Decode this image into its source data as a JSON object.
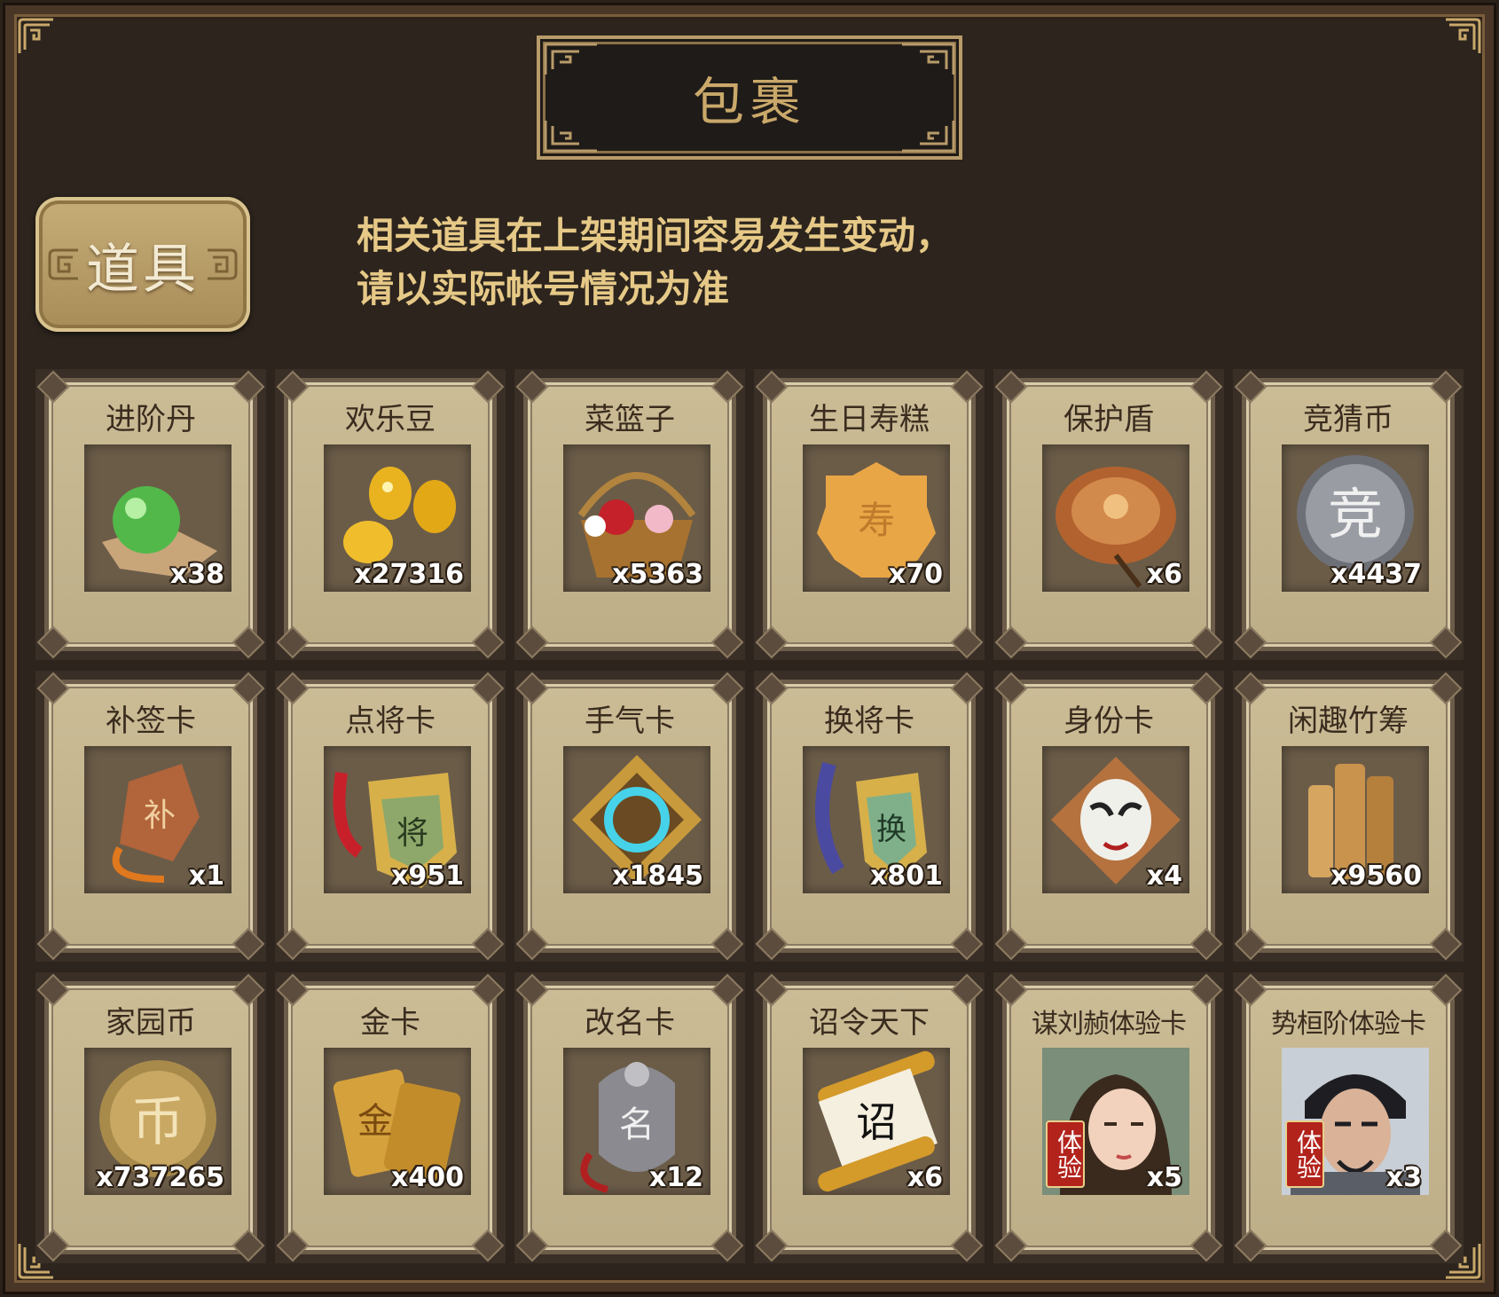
{
  "window": {
    "title": "包裹"
  },
  "tab": {
    "label": "道具"
  },
  "notice": {
    "line1": "相关道具在上架期间容易发生变动，",
    "line2": "请以实际帐号情况为准"
  },
  "items": [
    {
      "name": "进阶丹",
      "qty": "x38",
      "icon": "green-orb-icon"
    },
    {
      "name": "欢乐豆",
      "qty": "x27316",
      "icon": "gold-beans-icon"
    },
    {
      "name": "菜篮子",
      "qty": "x5363",
      "icon": "flower-basket-icon"
    },
    {
      "name": "生日寿糕",
      "qty": "x70",
      "icon": "birthday-cake-icon"
    },
    {
      "name": "保护盾",
      "qty": "x6",
      "icon": "shield-icon"
    },
    {
      "name": "竞猜币",
      "qty": "x4437",
      "icon": "silver-coin-icon"
    },
    {
      "name": "补签卡",
      "qty": "x1",
      "icon": "sign-card-icon"
    },
    {
      "name": "点将卡",
      "qty": "x951",
      "icon": "general-token-icon"
    },
    {
      "name": "手气卡",
      "qty": "x1845",
      "icon": "luck-card-icon"
    },
    {
      "name": "换将卡",
      "qty": "x801",
      "icon": "swap-token-icon"
    },
    {
      "name": "身份卡",
      "qty": "x4",
      "icon": "mask-card-icon"
    },
    {
      "name": "闲趣竹筹",
      "qty": "x9560",
      "icon": "bamboo-tally-icon"
    },
    {
      "name": "家园币",
      "qty": "x737265",
      "icon": "home-coin-icon"
    },
    {
      "name": "金卡",
      "qty": "x400",
      "icon": "gold-card-icon"
    },
    {
      "name": "改名卡",
      "qty": "x12",
      "icon": "rename-tag-icon"
    },
    {
      "name": "诏令天下",
      "qty": "x6",
      "icon": "edict-scroll-icon"
    },
    {
      "name": "谋刘赪体验卡",
      "qty": "x5",
      "icon": "female-hero-portrait-icon",
      "badge": "体验"
    },
    {
      "name": "势桓阶体验卡",
      "qty": "x3",
      "icon": "male-hero-portrait-icon",
      "badge": "体验"
    }
  ],
  "colors": {
    "background": "#2c241d",
    "title_text": "#c9a86a",
    "notice_text": "#e6c987",
    "card_face": "#c4b58f"
  }
}
